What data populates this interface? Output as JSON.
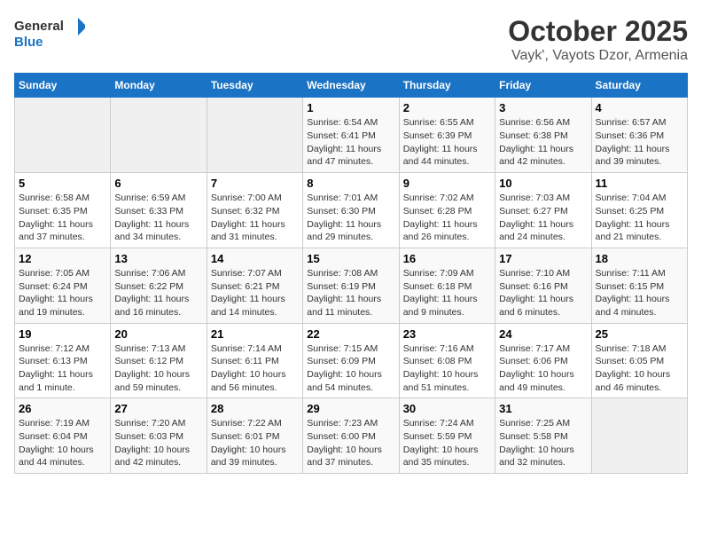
{
  "header": {
    "logo_line1": "General",
    "logo_line2": "Blue",
    "title": "October 2025",
    "subtitle": "Vayk', Vayots Dzor, Armenia"
  },
  "weekdays": [
    "Sunday",
    "Monday",
    "Tuesday",
    "Wednesday",
    "Thursday",
    "Friday",
    "Saturday"
  ],
  "weeks": [
    [
      {
        "day": "",
        "info": ""
      },
      {
        "day": "",
        "info": ""
      },
      {
        "day": "",
        "info": ""
      },
      {
        "day": "1",
        "info": "Sunrise: 6:54 AM\nSunset: 6:41 PM\nDaylight: 11 hours and 47 minutes."
      },
      {
        "day": "2",
        "info": "Sunrise: 6:55 AM\nSunset: 6:39 PM\nDaylight: 11 hours and 44 minutes."
      },
      {
        "day": "3",
        "info": "Sunrise: 6:56 AM\nSunset: 6:38 PM\nDaylight: 11 hours and 42 minutes."
      },
      {
        "day": "4",
        "info": "Sunrise: 6:57 AM\nSunset: 6:36 PM\nDaylight: 11 hours and 39 minutes."
      }
    ],
    [
      {
        "day": "5",
        "info": "Sunrise: 6:58 AM\nSunset: 6:35 PM\nDaylight: 11 hours and 37 minutes."
      },
      {
        "day": "6",
        "info": "Sunrise: 6:59 AM\nSunset: 6:33 PM\nDaylight: 11 hours and 34 minutes."
      },
      {
        "day": "7",
        "info": "Sunrise: 7:00 AM\nSunset: 6:32 PM\nDaylight: 11 hours and 31 minutes."
      },
      {
        "day": "8",
        "info": "Sunrise: 7:01 AM\nSunset: 6:30 PM\nDaylight: 11 hours and 29 minutes."
      },
      {
        "day": "9",
        "info": "Sunrise: 7:02 AM\nSunset: 6:28 PM\nDaylight: 11 hours and 26 minutes."
      },
      {
        "day": "10",
        "info": "Sunrise: 7:03 AM\nSunset: 6:27 PM\nDaylight: 11 hours and 24 minutes."
      },
      {
        "day": "11",
        "info": "Sunrise: 7:04 AM\nSunset: 6:25 PM\nDaylight: 11 hours and 21 minutes."
      }
    ],
    [
      {
        "day": "12",
        "info": "Sunrise: 7:05 AM\nSunset: 6:24 PM\nDaylight: 11 hours and 19 minutes."
      },
      {
        "day": "13",
        "info": "Sunrise: 7:06 AM\nSunset: 6:22 PM\nDaylight: 11 hours and 16 minutes."
      },
      {
        "day": "14",
        "info": "Sunrise: 7:07 AM\nSunset: 6:21 PM\nDaylight: 11 hours and 14 minutes."
      },
      {
        "day": "15",
        "info": "Sunrise: 7:08 AM\nSunset: 6:19 PM\nDaylight: 11 hours and 11 minutes."
      },
      {
        "day": "16",
        "info": "Sunrise: 7:09 AM\nSunset: 6:18 PM\nDaylight: 11 hours and 9 minutes."
      },
      {
        "day": "17",
        "info": "Sunrise: 7:10 AM\nSunset: 6:16 PM\nDaylight: 11 hours and 6 minutes."
      },
      {
        "day": "18",
        "info": "Sunrise: 7:11 AM\nSunset: 6:15 PM\nDaylight: 11 hours and 4 minutes."
      }
    ],
    [
      {
        "day": "19",
        "info": "Sunrise: 7:12 AM\nSunset: 6:13 PM\nDaylight: 11 hours and 1 minute."
      },
      {
        "day": "20",
        "info": "Sunrise: 7:13 AM\nSunset: 6:12 PM\nDaylight: 10 hours and 59 minutes."
      },
      {
        "day": "21",
        "info": "Sunrise: 7:14 AM\nSunset: 6:11 PM\nDaylight: 10 hours and 56 minutes."
      },
      {
        "day": "22",
        "info": "Sunrise: 7:15 AM\nSunset: 6:09 PM\nDaylight: 10 hours and 54 minutes."
      },
      {
        "day": "23",
        "info": "Sunrise: 7:16 AM\nSunset: 6:08 PM\nDaylight: 10 hours and 51 minutes."
      },
      {
        "day": "24",
        "info": "Sunrise: 7:17 AM\nSunset: 6:06 PM\nDaylight: 10 hours and 49 minutes."
      },
      {
        "day": "25",
        "info": "Sunrise: 7:18 AM\nSunset: 6:05 PM\nDaylight: 10 hours and 46 minutes."
      }
    ],
    [
      {
        "day": "26",
        "info": "Sunrise: 7:19 AM\nSunset: 6:04 PM\nDaylight: 10 hours and 44 minutes."
      },
      {
        "day": "27",
        "info": "Sunrise: 7:20 AM\nSunset: 6:03 PM\nDaylight: 10 hours and 42 minutes."
      },
      {
        "day": "28",
        "info": "Sunrise: 7:22 AM\nSunset: 6:01 PM\nDaylight: 10 hours and 39 minutes."
      },
      {
        "day": "29",
        "info": "Sunrise: 7:23 AM\nSunset: 6:00 PM\nDaylight: 10 hours and 37 minutes."
      },
      {
        "day": "30",
        "info": "Sunrise: 7:24 AM\nSunset: 5:59 PM\nDaylight: 10 hours and 35 minutes."
      },
      {
        "day": "31",
        "info": "Sunrise: 7:25 AM\nSunset: 5:58 PM\nDaylight: 10 hours and 32 minutes."
      },
      {
        "day": "",
        "info": ""
      }
    ]
  ]
}
